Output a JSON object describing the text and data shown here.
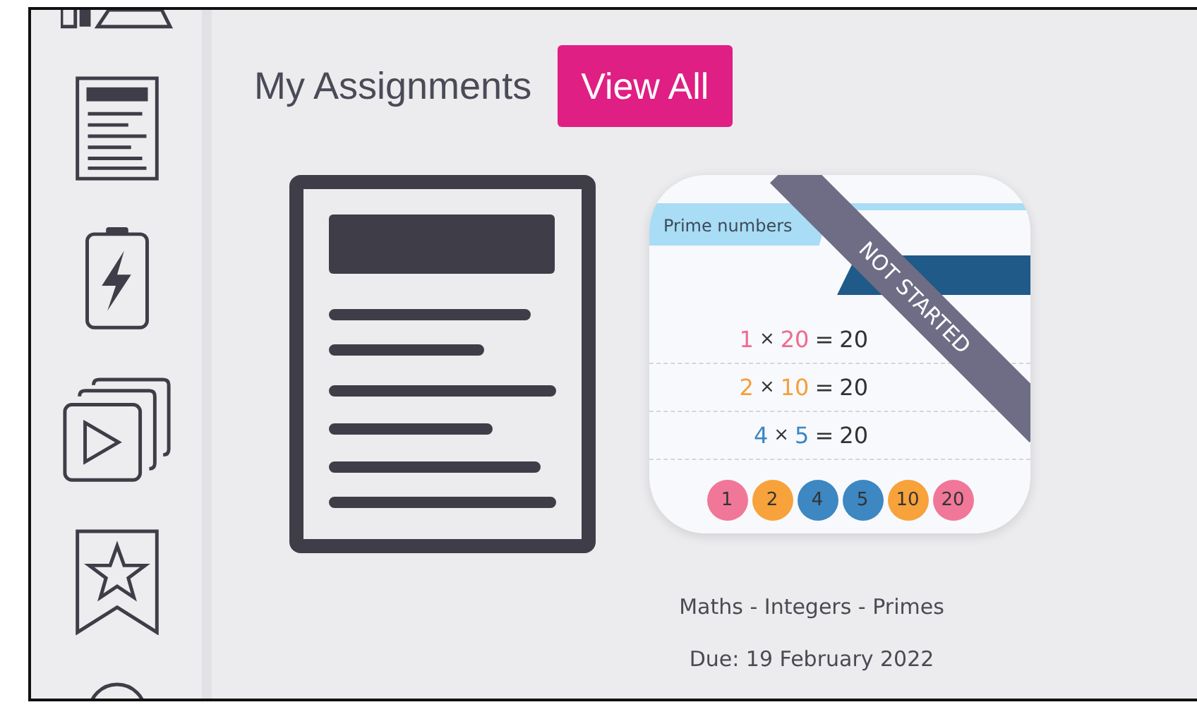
{
  "header": {
    "title": "My Assignments",
    "view_all_button": "View All"
  },
  "assignments": [
    {
      "kind": "document"
    },
    {
      "kind": "thumbnail",
      "status": "NOT STARTED",
      "thumbnail": {
        "title": "Prime numbers",
        "equations": [
          {
            "factor_a": "1",
            "times": "×",
            "factor_b": "20",
            "equals": "=",
            "product": "20",
            "color": "#f06b8e"
          },
          {
            "factor_a": "2",
            "times": "×",
            "factor_b": "10",
            "equals": "=",
            "product": "20",
            "color": "#f5a03a"
          },
          {
            "factor_a": "4",
            "times": "×",
            "factor_b": "5",
            "equals": "=",
            "product": "20",
            "color": "#3b86c4"
          }
        ],
        "factors": [
          {
            "label": "1",
            "color": "#f07797"
          },
          {
            "label": "2",
            "color": "#f7a23a"
          },
          {
            "label": "4",
            "color": "#3d87c2"
          },
          {
            "label": "5",
            "color": "#3d87c2"
          },
          {
            "label": "10",
            "color": "#f7a23a"
          },
          {
            "label": "20",
            "color": "#f07797"
          }
        ]
      },
      "subject": "Maths - Integers - Primes",
      "due": "Due: 19 February 2022"
    }
  ]
}
